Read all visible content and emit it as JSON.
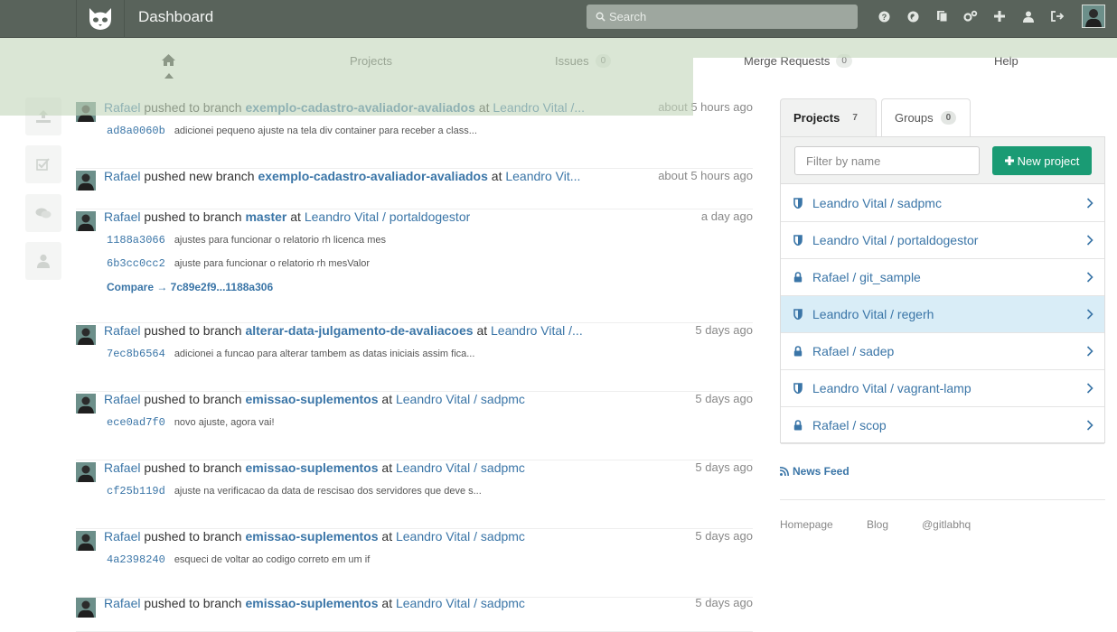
{
  "header": {
    "title": "Dashboard",
    "search_placeholder": "Search",
    "icons": [
      "help-icon",
      "explore-icon",
      "snippets-icon",
      "admin-icon",
      "new-icon",
      "profile-icon",
      "logout-icon"
    ]
  },
  "nav": {
    "home_icon": "home-icon",
    "projects": "Projects",
    "issues": "Issues",
    "issues_count": "0",
    "merge_requests": "Merge Requests",
    "merge_requests_count": "0",
    "help": "Help"
  },
  "side_icons": [
    "push-events-icon",
    "issue-events-icon",
    "comments-icon",
    "team-events-icon"
  ],
  "events": [
    {
      "user": "Rafael",
      "action": "pushed to branch",
      "branch": "exemplo-cadastro-avaliador-avaliados",
      "at": "at",
      "project": "Leandro Vital /...",
      "time": "about 5 hours ago",
      "commits": [
        {
          "sha": "ad8a0060b",
          "msg": "adicionei pequeno ajuste na tela div container para receber a class..."
        }
      ]
    },
    {
      "user": "Rafael",
      "action": "pushed new branch",
      "branch": "exemplo-cadastro-avaliador-avaliados",
      "at": "at",
      "project": "Leandro Vit...",
      "time": "about 5 hours ago",
      "commits": []
    },
    {
      "user": "Rafael",
      "action": "pushed to branch",
      "branch": "master",
      "at": "at",
      "project": "Leandro Vital / portaldogestor",
      "time": "a day ago",
      "commits": [
        {
          "sha": "1188a3066",
          "msg": "ajustes para funcionar o relatorio rh licenca mes"
        },
        {
          "sha": "6b3cc0cc2",
          "msg": "ajuste para funcionar o relatorio rh mesValor"
        }
      ],
      "compare": "Compare → 7c89e2f9...1188a306"
    },
    {
      "user": "Rafael",
      "action": "pushed to branch",
      "branch": "alterar-data-julgamento-de-avaliacoes",
      "at": "at",
      "project": "Leandro Vital /...",
      "time": "5 days ago",
      "commits": [
        {
          "sha": "7ec8b6564",
          "msg": "adicionei a funcao para alterar tambem as datas iniciais assim fica..."
        }
      ]
    },
    {
      "user": "Rafael",
      "action": "pushed to branch",
      "branch": "emissao-suplementos",
      "at": "at",
      "project": "Leandro Vital / sadpmc",
      "time": "5 days ago",
      "commits": [
        {
          "sha": "ece0ad7f0",
          "msg": "novo ajuste, agora vai!"
        }
      ]
    },
    {
      "user": "Rafael",
      "action": "pushed to branch",
      "branch": "emissao-suplementos",
      "at": "at",
      "project": "Leandro Vital / sadpmc",
      "time": "5 days ago",
      "commits": [
        {
          "sha": "cf25b119d",
          "msg": "ajuste na verificacao da data de rescisao dos servidores que deve s..."
        }
      ]
    },
    {
      "user": "Rafael",
      "action": "pushed to branch",
      "branch": "emissao-suplementos",
      "at": "at",
      "project": "Leandro Vital / sadpmc",
      "time": "5 days ago",
      "commits": [
        {
          "sha": "4a2398240",
          "msg": "esqueci de voltar ao codigo correto em um if"
        }
      ]
    },
    {
      "user": "Rafael",
      "action": "pushed to branch",
      "branch": "emissao-suplementos",
      "at": "at",
      "project": "Leandro Vital / sadpmc",
      "time": "5 days ago",
      "commits": []
    }
  ],
  "sidebar": {
    "tab_projects": "Projects",
    "tab_projects_count": "7",
    "tab_groups": "Groups",
    "tab_groups_count": "0",
    "filter_placeholder": "Filter by name",
    "new_project": "New project",
    "projects": [
      {
        "name": "Leandro Vital / sadpmc",
        "icon": "shield-icon"
      },
      {
        "name": "Leandro Vital / portaldogestor",
        "icon": "shield-icon"
      },
      {
        "name": "Rafael / git_sample",
        "icon": "lock-icon"
      },
      {
        "name": "Leandro Vital / regerh",
        "icon": "shield-icon"
      },
      {
        "name": "Rafael / sadep",
        "icon": "lock-icon"
      },
      {
        "name": "Leandro Vital / vagrant-lamp",
        "icon": "shield-icon"
      },
      {
        "name": "Rafael / scop",
        "icon": "lock-icon"
      }
    ],
    "news_feed": "News Feed",
    "footer": [
      "Homepage",
      "Blog",
      "@gitlabhq"
    ]
  },
  "colors": {
    "header": "#59635b",
    "link": "#3a75a7",
    "new_project_button": "#1a9b74",
    "highlight_row": "#d9edf7"
  }
}
